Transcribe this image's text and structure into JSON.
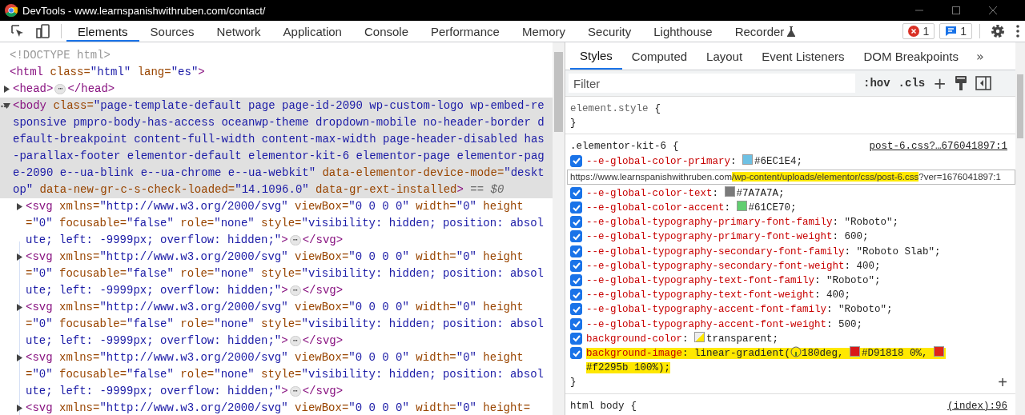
{
  "window": {
    "title": "DevTools - www.learnspanishwithruben.com/contact/"
  },
  "toolbar": {
    "tabs": [
      {
        "label": "Elements",
        "selected": true,
        "kind": "plain"
      },
      {
        "label": "Sources",
        "selected": false,
        "kind": "plain"
      },
      {
        "label": "Network",
        "selected": false,
        "kind": "plain"
      },
      {
        "label": "Application",
        "selected": false,
        "kind": "plain"
      },
      {
        "label": "Console",
        "selected": false,
        "kind": "plain"
      },
      {
        "label": "Performance",
        "selected": false,
        "kind": "plain"
      },
      {
        "label": "Memory",
        "selected": false,
        "kind": "plain"
      },
      {
        "label": "Security",
        "selected": false,
        "kind": "plain"
      },
      {
        "label": "Lighthouse",
        "selected": false,
        "kind": "plain"
      },
      {
        "label": "Recorder",
        "selected": false,
        "kind": "experimental"
      }
    ],
    "errors": "1",
    "messages": "1"
  },
  "elements_tree": [
    {
      "kind": "doctype",
      "selected": false,
      "tokens": [
        {
          "kind": "text",
          "s": "<!DOCTYPE html>"
        }
      ]
    },
    {
      "kind": "element",
      "selected": false,
      "tokens": [
        {
          "kind": "tag",
          "s": "<html"
        },
        {
          "kind": "attr",
          "s": " class="
        },
        {
          "kind": "value",
          "s": "\"html\""
        },
        {
          "kind": "attr",
          "s": " lang="
        },
        {
          "kind": "value",
          "s": "\"es\""
        },
        {
          "kind": "tag",
          "s": ">"
        }
      ],
      "children": [
        {
          "kind": "element",
          "selected": false,
          "expanded": false,
          "tokens": [
            {
              "kind": "tag",
              "s": "<head>"
            },
            {
              "kind": "ellipsis",
              "s": "⋯"
            },
            {
              "kind": "tag",
              "s": "</head>"
            }
          ]
        },
        {
          "kind": "element",
          "selected": true,
          "expanded": true,
          "tokens": [
            {
              "kind": "tag",
              "s": "<body"
            },
            {
              "kind": "attr",
              "s": " class="
            },
            {
              "kind": "value",
              "s": "\"page-template-default page page-id-2090 wp-custom-logo wp-embed-responsive pmpro-body-has-access oceanwp-theme dropdown-mobile no-header-border default-breakpoint content-full-width content-max-width page-header-disabled has-parallax-footer elementor-default elementor-kit-6 elementor-page elementor-page-2090 e--ua-blink e--ua-chrome e--ua-webkit\""
            },
            {
              "kind": "attr",
              "s": " data-elementor-device-mode="
            },
            {
              "kind": "value",
              "s": "\"desktop\""
            },
            {
              "kind": "attr",
              "s": " data-new-gr-c-s-check-loaded="
            },
            {
              "kind": "value",
              "s": "\"14.1096.0\""
            },
            {
              "kind": "attr",
              "s": " data-gr-ext-installed"
            },
            {
              "kind": "tag",
              "s": ">"
            },
            {
              "kind": "comment",
              "s": " == $0"
            }
          ],
          "children": [
            {
              "kind": "element",
              "selected": false,
              "expanded": false,
              "tokens": [
                {
                  "kind": "tag",
                  "s": "<svg"
                },
                {
                  "kind": "attr",
                  "s": " xmlns="
                },
                {
                  "kind": "value",
                  "s": "\"http://www.w3.org/2000/svg\""
                },
                {
                  "kind": "attr",
                  "s": " viewBox="
                },
                {
                  "kind": "value",
                  "s": "\"0 0 0 0\""
                },
                {
                  "kind": "attr",
                  "s": " width="
                },
                {
                  "kind": "value",
                  "s": "\"0\""
                },
                {
                  "kind": "attr",
                  "s": " height="
                },
                {
                  "kind": "value",
                  "s": "\"0\""
                },
                {
                  "kind": "attr",
                  "s": " focusable="
                },
                {
                  "kind": "value",
                  "s": "\"false\""
                },
                {
                  "kind": "attr",
                  "s": " role="
                },
                {
                  "kind": "value",
                  "s": "\"none\""
                },
                {
                  "kind": "attr",
                  "s": " style="
                },
                {
                  "kind": "value",
                  "s": "\"visibility: hidden; position: absolute; left: -9999px; overflow: hidden;\""
                },
                {
                  "kind": "tag",
                  "s": ">"
                },
                {
                  "kind": "ellipsis",
                  "s": "⋯"
                },
                {
                  "kind": "tag",
                  "s": "</svg>"
                }
              ]
            },
            {
              "kind": "element",
              "selected": false,
              "expanded": false,
              "tokens": [
                {
                  "kind": "tag",
                  "s": "<svg"
                },
                {
                  "kind": "attr",
                  "s": " xmlns="
                },
                {
                  "kind": "value",
                  "s": "\"http://www.w3.org/2000/svg\""
                },
                {
                  "kind": "attr",
                  "s": " viewBox="
                },
                {
                  "kind": "value",
                  "s": "\"0 0 0 0\""
                },
                {
                  "kind": "attr",
                  "s": " width="
                },
                {
                  "kind": "value",
                  "s": "\"0\""
                },
                {
                  "kind": "attr",
                  "s": " height="
                },
                {
                  "kind": "value",
                  "s": "\"0\""
                },
                {
                  "kind": "attr",
                  "s": " focusable="
                },
                {
                  "kind": "value",
                  "s": "\"false\""
                },
                {
                  "kind": "attr",
                  "s": " role="
                },
                {
                  "kind": "value",
                  "s": "\"none\""
                },
                {
                  "kind": "attr",
                  "s": " style="
                },
                {
                  "kind": "value",
                  "s": "\"visibility: hidden; position: absolute; left: -9999px; overflow: hidden;\""
                },
                {
                  "kind": "tag",
                  "s": ">"
                },
                {
                  "kind": "ellipsis",
                  "s": "⋯"
                },
                {
                  "kind": "tag",
                  "s": "</svg>"
                }
              ]
            },
            {
              "kind": "element",
              "selected": false,
              "expanded": false,
              "tokens": [
                {
                  "kind": "tag",
                  "s": "<svg"
                },
                {
                  "kind": "attr",
                  "s": " xmlns="
                },
                {
                  "kind": "value",
                  "s": "\"http://www.w3.org/2000/svg\""
                },
                {
                  "kind": "attr",
                  "s": " viewBox="
                },
                {
                  "kind": "value",
                  "s": "\"0 0 0 0\""
                },
                {
                  "kind": "attr",
                  "s": " width="
                },
                {
                  "kind": "value",
                  "s": "\"0\""
                },
                {
                  "kind": "attr",
                  "s": " height="
                },
                {
                  "kind": "value",
                  "s": "\"0\""
                },
                {
                  "kind": "attr",
                  "s": " focusable="
                },
                {
                  "kind": "value",
                  "s": "\"false\""
                },
                {
                  "kind": "attr",
                  "s": " role="
                },
                {
                  "kind": "value",
                  "s": "\"none\""
                },
                {
                  "kind": "attr",
                  "s": " style="
                },
                {
                  "kind": "value",
                  "s": "\"visibility: hidden; position: absolute; left: -9999px; overflow: hidden;\""
                },
                {
                  "kind": "tag",
                  "s": ">"
                },
                {
                  "kind": "ellipsis",
                  "s": "⋯"
                },
                {
                  "kind": "tag",
                  "s": "</svg>"
                }
              ]
            },
            {
              "kind": "element",
              "selected": false,
              "expanded": false,
              "tokens": [
                {
                  "kind": "tag",
                  "s": "<svg"
                },
                {
                  "kind": "attr",
                  "s": " xmlns="
                },
                {
                  "kind": "value",
                  "s": "\"http://www.w3.org/2000/svg\""
                },
                {
                  "kind": "attr",
                  "s": " viewBox="
                },
                {
                  "kind": "value",
                  "s": "\"0 0 0 0\""
                },
                {
                  "kind": "attr",
                  "s": " width="
                },
                {
                  "kind": "value",
                  "s": "\"0\""
                },
                {
                  "kind": "attr",
                  "s": " height="
                },
                {
                  "kind": "value",
                  "s": "\"0\""
                },
                {
                  "kind": "attr",
                  "s": " focusable="
                },
                {
                  "kind": "value",
                  "s": "\"false\""
                },
                {
                  "kind": "attr",
                  "s": " role="
                },
                {
                  "kind": "value",
                  "s": "\"none\""
                },
                {
                  "kind": "attr",
                  "s": " style="
                },
                {
                  "kind": "value",
                  "s": "\"visibility: hidden; position: absolute; left: -9999px; overflow: hidden;\""
                },
                {
                  "kind": "tag",
                  "s": ">"
                },
                {
                  "kind": "ellipsis",
                  "s": "⋯"
                },
                {
                  "kind": "tag",
                  "s": "</svg>"
                }
              ]
            },
            {
              "kind": "element",
              "selected": false,
              "expanded": false,
              "tokens": [
                {
                  "kind": "tag",
                  "s": "<svg"
                },
                {
                  "kind": "attr",
                  "s": " xmlns="
                },
                {
                  "kind": "value",
                  "s": "\"http://www.w3.org/2000/svg\""
                },
                {
                  "kind": "attr",
                  "s": " viewBox="
                },
                {
                  "kind": "value",
                  "s": "\"0 0 0 0\""
                },
                {
                  "kind": "attr",
                  "s": " width="
                },
                {
                  "kind": "value",
                  "s": "\"0\""
                },
                {
                  "kind": "attr",
                  "s": " height="
                }
              ]
            }
          ]
        }
      ]
    }
  ],
  "styles_pane": {
    "tabs": [
      {
        "label": "Styles",
        "selected": true
      },
      {
        "label": "Computed",
        "selected": false
      },
      {
        "label": "Layout",
        "selected": false
      },
      {
        "label": "Event Listeners",
        "selected": false
      },
      {
        "label": "DOM Breakpoints",
        "selected": false
      }
    ],
    "more": "»",
    "filter": {
      "placeholder": "Filter"
    },
    "toggles": [
      ":hov",
      ".cls"
    ],
    "new_rule": "+",
    "rules": [
      {
        "selector": "element.style",
        "kind": "inline",
        "open": "{",
        "close": "}"
      },
      {
        "selector": ".elementor-kit-6",
        "kind": "stylesheet",
        "open": "{",
        "close": "}",
        "source": "post-6.css?…676041897:1",
        "add": "+",
        "items": [
          {
            "kind": "declaration",
            "checked": true,
            "highlighted": false,
            "name": "--e-global-color-primary",
            "value": [
              {
                "kind": "text",
                "s": ": "
              },
              {
                "kind": "swatch",
                "color": "#6ec1e4"
              },
              {
                "kind": "text",
                "s": "#6EC1E4;"
              }
            ]
          },
          {
            "kind": "tooltip",
            "segments": [
              {
                "s": "https://www.learnspanishwithruben.com",
                "highlighted": false
              },
              {
                "s": "/wp-content/uploads/elementor/css/post-6.css",
                "highlighted": true
              },
              {
                "s": "?ver=1676041897:1",
                "highlighted": false
              }
            ]
          },
          {
            "kind": "declaration",
            "checked": true,
            "highlighted": false,
            "name": "--e-global-color-text",
            "value": [
              {
                "kind": "text",
                "s": ": "
              },
              {
                "kind": "swatch",
                "color": "#7a7a7a"
              },
              {
                "kind": "text",
                "s": "#7A7A7A;"
              }
            ]
          },
          {
            "kind": "declaration",
            "checked": true,
            "highlighted": false,
            "name": "--e-global-color-accent",
            "value": [
              {
                "kind": "text",
                "s": ": "
              },
              {
                "kind": "swatch",
                "color": "#61ce70"
              },
              {
                "kind": "text",
                "s": "#61CE70;"
              }
            ]
          },
          {
            "kind": "declaration",
            "checked": true,
            "highlighted": false,
            "name": "--e-global-typography-primary-font-family",
            "value": [
              {
                "kind": "text",
                "s": ": \"Roboto\";"
              }
            ]
          },
          {
            "kind": "declaration",
            "checked": true,
            "highlighted": false,
            "name": "--e-global-typography-primary-font-weight",
            "value": [
              {
                "kind": "text",
                "s": ": 600;"
              }
            ]
          },
          {
            "kind": "declaration",
            "checked": true,
            "highlighted": false,
            "name": "--e-global-typography-secondary-font-family",
            "value": [
              {
                "kind": "text",
                "s": ": \"Roboto Slab\";"
              }
            ]
          },
          {
            "kind": "declaration",
            "checked": true,
            "highlighted": false,
            "name": "--e-global-typography-secondary-font-weight",
            "value": [
              {
                "kind": "text",
                "s": ": 400;"
              }
            ]
          },
          {
            "kind": "declaration",
            "checked": true,
            "highlighted": false,
            "name": "--e-global-typography-text-font-family",
            "value": [
              {
                "kind": "text",
                "s": ": \"Roboto\";"
              }
            ]
          },
          {
            "kind": "declaration",
            "checked": true,
            "highlighted": false,
            "name": "--e-global-typography-text-font-weight",
            "value": [
              {
                "kind": "text",
                "s": ": 400;"
              }
            ]
          },
          {
            "kind": "declaration",
            "checked": true,
            "highlighted": false,
            "name": "--e-global-typography-accent-font-family",
            "value": [
              {
                "kind": "text",
                "s": ": \"Roboto\";"
              }
            ]
          },
          {
            "kind": "declaration",
            "checked": true,
            "highlighted": false,
            "name": "--e-global-typography-accent-font-weight",
            "value": [
              {
                "kind": "text",
                "s": ": 500;"
              }
            ]
          },
          {
            "kind": "declaration",
            "checked": true,
            "highlighted": false,
            "name": "background-color",
            "value": [
              {
                "kind": "text",
                "s": ": "
              },
              {
                "kind": "transparent-swatch"
              },
              {
                "kind": "text",
                "s": "transparent;"
              }
            ]
          },
          {
            "kind": "declaration",
            "checked": true,
            "highlighted": true,
            "name": "background-image",
            "value": [
              {
                "kind": "text",
                "s": ": linear-gradient("
              },
              {
                "kind": "angle"
              },
              {
                "kind": "text",
                "s": "180deg, "
              },
              {
                "kind": "swatch",
                "color": "#d91818"
              },
              {
                "kind": "text",
                "s": "#D91818 0%, "
              },
              {
                "kind": "swatch",
                "color": "#e02418"
              },
              {
                "kind": "text",
                "s": "#f2295b 100%);"
              }
            ]
          }
        ]
      },
      {
        "selector": "html body",
        "kind": "stylesheet",
        "open": "{",
        "source": "(index):96"
      }
    ]
  }
}
